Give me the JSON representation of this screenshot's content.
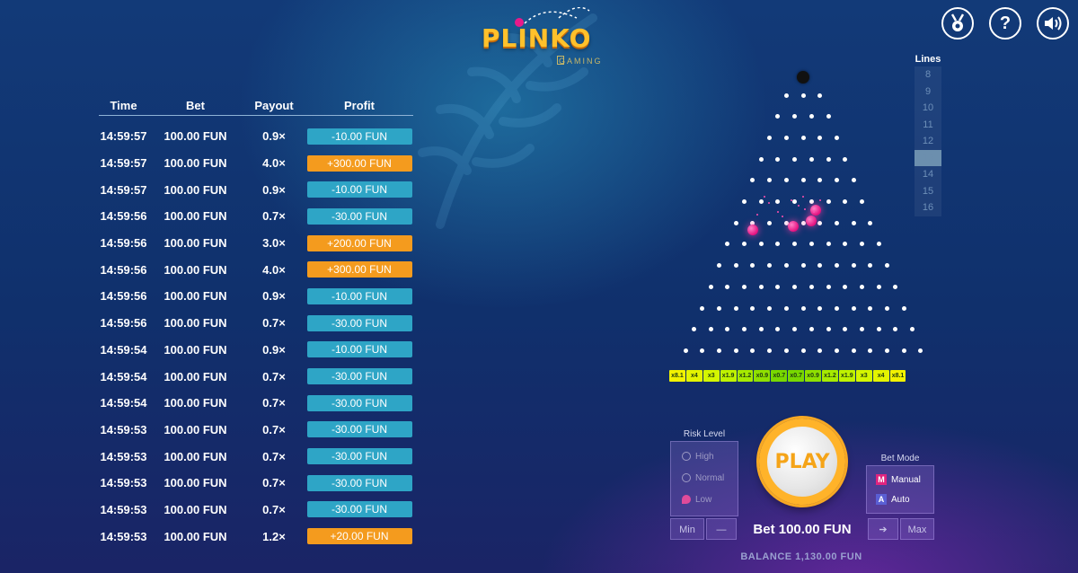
{
  "header": {
    "logo_text": "PLINKO",
    "logo_sub": "GAMING",
    "icons": [
      "achievement-icon",
      "help-icon",
      "sound-icon"
    ],
    "help_glyph": "?"
  },
  "history": {
    "headers": {
      "time": "Time",
      "bet": "Bet",
      "payout": "Payout",
      "profit": "Profit"
    },
    "rows": [
      {
        "time": "14:59:57",
        "bet": "100.00 FUN",
        "payout": "0.9×",
        "profit": "-10.00 FUN",
        "positive": false
      },
      {
        "time": "14:59:57",
        "bet": "100.00 FUN",
        "payout": "4.0×",
        "profit": "+300.00 FUN",
        "positive": true
      },
      {
        "time": "14:59:57",
        "bet": "100.00 FUN",
        "payout": "0.9×",
        "profit": "-10.00 FUN",
        "positive": false
      },
      {
        "time": "14:59:56",
        "bet": "100.00 FUN",
        "payout": "0.7×",
        "profit": "-30.00 FUN",
        "positive": false
      },
      {
        "time": "14:59:56",
        "bet": "100.00 FUN",
        "payout": "3.0×",
        "profit": "+200.00 FUN",
        "positive": true
      },
      {
        "time": "14:59:56",
        "bet": "100.00 FUN",
        "payout": "4.0×",
        "profit": "+300.00 FUN",
        "positive": true
      },
      {
        "time": "14:59:56",
        "bet": "100.00 FUN",
        "payout": "0.9×",
        "profit": "-10.00 FUN",
        "positive": false
      },
      {
        "time": "14:59:56",
        "bet": "100.00 FUN",
        "payout": "0.7×",
        "profit": "-30.00 FUN",
        "positive": false
      },
      {
        "time": "14:59:54",
        "bet": "100.00 FUN",
        "payout": "0.9×",
        "profit": "-10.00 FUN",
        "positive": false
      },
      {
        "time": "14:59:54",
        "bet": "100.00 FUN",
        "payout": "0.7×",
        "profit": "-30.00 FUN",
        "positive": false
      },
      {
        "time": "14:59:54",
        "bet": "100.00 FUN",
        "payout": "0.7×",
        "profit": "-30.00 FUN",
        "positive": false
      },
      {
        "time": "14:59:53",
        "bet": "100.00 FUN",
        "payout": "0.7×",
        "profit": "-30.00 FUN",
        "positive": false
      },
      {
        "time": "14:59:53",
        "bet": "100.00 FUN",
        "payout": "0.7×",
        "profit": "-30.00 FUN",
        "positive": false
      },
      {
        "time": "14:59:53",
        "bet": "100.00 FUN",
        "payout": "0.7×",
        "profit": "-30.00 FUN",
        "positive": false
      },
      {
        "time": "14:59:53",
        "bet": "100.00 FUN",
        "payout": "0.7×",
        "profit": "-30.00 FUN",
        "positive": false
      },
      {
        "time": "14:59:53",
        "bet": "100.00 FUN",
        "payout": "1.2×",
        "profit": "+20.00 FUN",
        "positive": true
      }
    ]
  },
  "board": {
    "lines": 13,
    "multipliers": [
      "x8.1",
      "x4",
      "x3",
      "x1.9",
      "x1.2",
      "x0.9",
      "x0.7",
      "x0.7",
      "x0.9",
      "x1.2",
      "x1.9",
      "x3",
      "x4",
      "x8.1"
    ],
    "slot_colors": [
      "#f2f200",
      "#e4f400",
      "#d4f600",
      "#bff200",
      "#a6ea00",
      "#8fe000",
      "#78d800",
      "#78d800",
      "#8fe000",
      "#a6ea00",
      "#bff200",
      "#d4f600",
      "#e4f400",
      "#f2f200"
    ]
  },
  "lines_selector": {
    "title": "Lines",
    "options": [
      "8",
      "9",
      "10",
      "11",
      "12",
      "13",
      "14",
      "15",
      "16"
    ],
    "selected": "13"
  },
  "risk": {
    "title": "Risk Level",
    "options": [
      {
        "label": "High",
        "icon": "high-risk-icon"
      },
      {
        "label": "Normal",
        "icon": "normal-risk-icon"
      },
      {
        "label": "Low",
        "icon": "low-risk-icon"
      }
    ]
  },
  "play": {
    "label": "PLAY"
  },
  "bet_mode": {
    "title": "Bet Mode",
    "options": [
      {
        "key": "M",
        "label": "Manual",
        "key_color": "#e0247f"
      },
      {
        "key": "A",
        "label": "Auto",
        "key_color": "#5a5fd4"
      }
    ]
  },
  "bet": {
    "min_label": "Min",
    "decrease_label": "—",
    "amount_label": "Bet 100.00 FUN",
    "increase_label": "➔",
    "max_label": "Max"
  },
  "balance": {
    "label": "BALANCE 1,130.00 FUN"
  }
}
